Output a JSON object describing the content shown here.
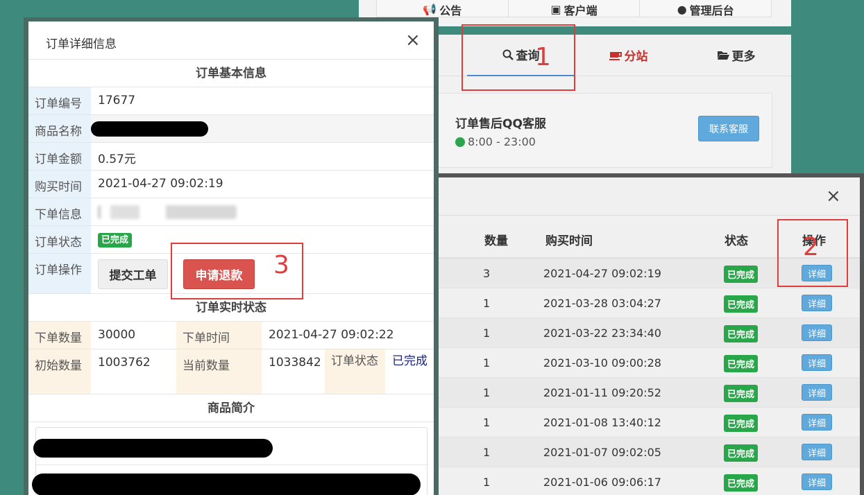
{
  "background": {
    "top_nav": [
      "公告",
      "客户端",
      "管理后台"
    ],
    "tabs": [
      {
        "label": "查询",
        "icon": "search-icon"
      },
      {
        "label": "分站",
        "icon": "coffee-icon"
      },
      {
        "label": "更多",
        "icon": "folder-open-icon"
      }
    ],
    "service": {
      "title": "订单售后QQ客服",
      "hours": "8:00 - 23:00",
      "button": "联系客服"
    }
  },
  "orders_modal": {
    "close": "×",
    "headers": {
      "qty": "数量",
      "time": "购买时间",
      "status": "状态",
      "action": "操作"
    },
    "rows": [
      {
        "qty": "3",
        "time": "2021-04-27 09:02:19",
        "status": "已完成",
        "action": "详细"
      },
      {
        "qty": "1",
        "time": "2021-03-28 03:04:27",
        "status": "已完成",
        "action": "详细"
      },
      {
        "qty": "1",
        "time": "2021-03-22 23:34:40",
        "status": "已完成",
        "action": "详细"
      },
      {
        "qty": "1",
        "time": "2021-03-10 09:00:28",
        "status": "已完成",
        "action": "详细"
      },
      {
        "qty": "1",
        "time": "2021-01-11 09:20:52",
        "status": "已完成",
        "action": "详细"
      },
      {
        "qty": "1",
        "time": "2021-01-08 13:40:12",
        "status": "已完成",
        "action": "详细"
      },
      {
        "qty": "1",
        "time": "2021-01-07 09:02:05",
        "status": "已完成",
        "action": "详细"
      },
      {
        "qty": "1",
        "time": "2021-01-06 09:06:17",
        "status": "已完成",
        "action": "详细"
      }
    ]
  },
  "detail_modal": {
    "title": "订单详细信息",
    "close": "×",
    "basic_section": "订单基本信息",
    "basic": {
      "order_no_label": "订单编号",
      "order_no": "17677",
      "product_label": "商品名称",
      "amount_label": "订单金额",
      "amount": "0.57元",
      "buy_time_label": "购买时间",
      "buy_time": "2021-04-27 09:02:19",
      "info_label": "下单信息",
      "status_label": "订单状态",
      "status": "已完成",
      "ops_label": "订单操作",
      "ticket_btn": "提交工单",
      "refund_btn": "申请退款"
    },
    "realtime_section": "订单实时状态",
    "realtime": {
      "order_qty_label": "下单数量",
      "order_qty": "30000",
      "order_time_label": "下单时间",
      "order_time": "2021-04-27 09:02:22",
      "init_qty_label": "初始数量",
      "init_qty": "1003762",
      "cur_qty_label": "当前数量",
      "cur_qty": "1033842",
      "state_label": "订单状态",
      "state": "已完成"
    },
    "intro_section": "商品简介"
  },
  "annotations": [
    "1",
    "2",
    "3"
  ]
}
